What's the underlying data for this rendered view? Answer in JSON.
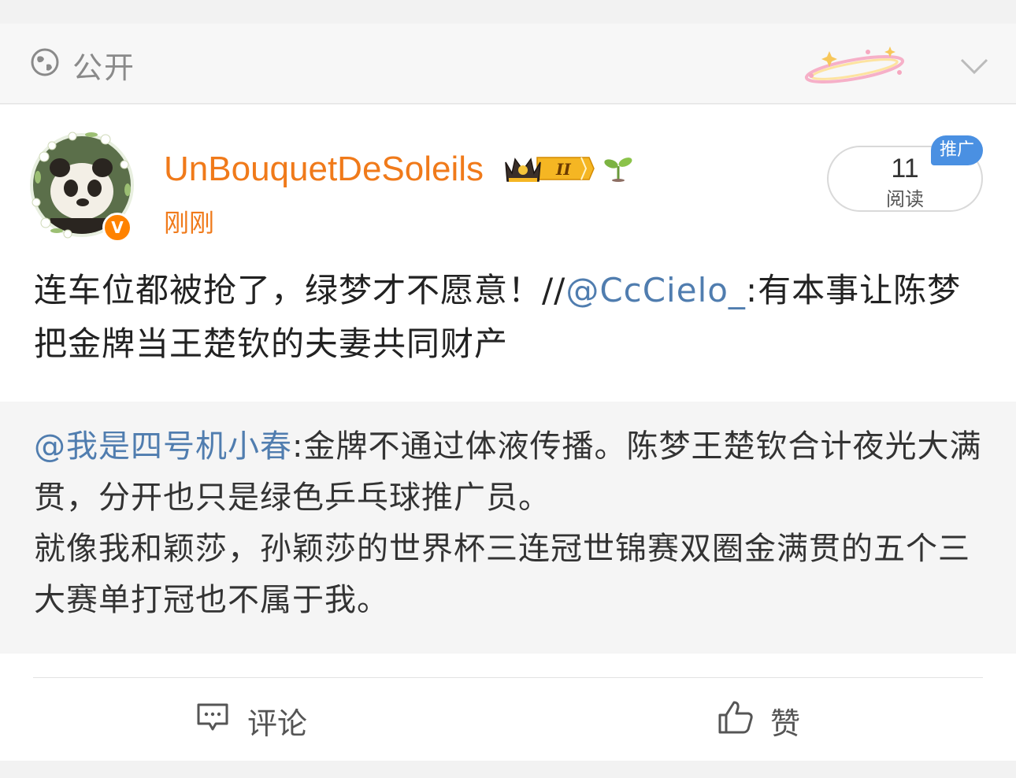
{
  "visibility": {
    "label": "公开",
    "icon": "globe-icon"
  },
  "author": {
    "name": "UnBouquetDeSoleils",
    "time": "刚刚",
    "badge_level": "II",
    "verified_mark": "V"
  },
  "reads": {
    "count": "11",
    "label": "阅读",
    "promo": "推广"
  },
  "post": {
    "text_before": "连车位都被抢了，绿梦才不愿意！//",
    "mention": "@CcCielo_",
    "text_after": ":有本事让陈梦把金牌当王楚钦的夫妻共同财产"
  },
  "repost": {
    "mention": "@我是四号机小春",
    "text": ":金牌不通过体液传播。陈梦王楚钦合计夜光大满贯，分开也只是绿色乒乓球推广员。",
    "text2": "就像我和颖莎，孙颖莎的世界杯三连冠世锦赛双圈金满贯的五个三大赛单打冠也不属于我。"
  },
  "actions": {
    "comment": "评论",
    "like": "赞"
  },
  "colors": {
    "accent": "#f07a1a",
    "link": "#507daf",
    "promo": "#4a90e2"
  }
}
